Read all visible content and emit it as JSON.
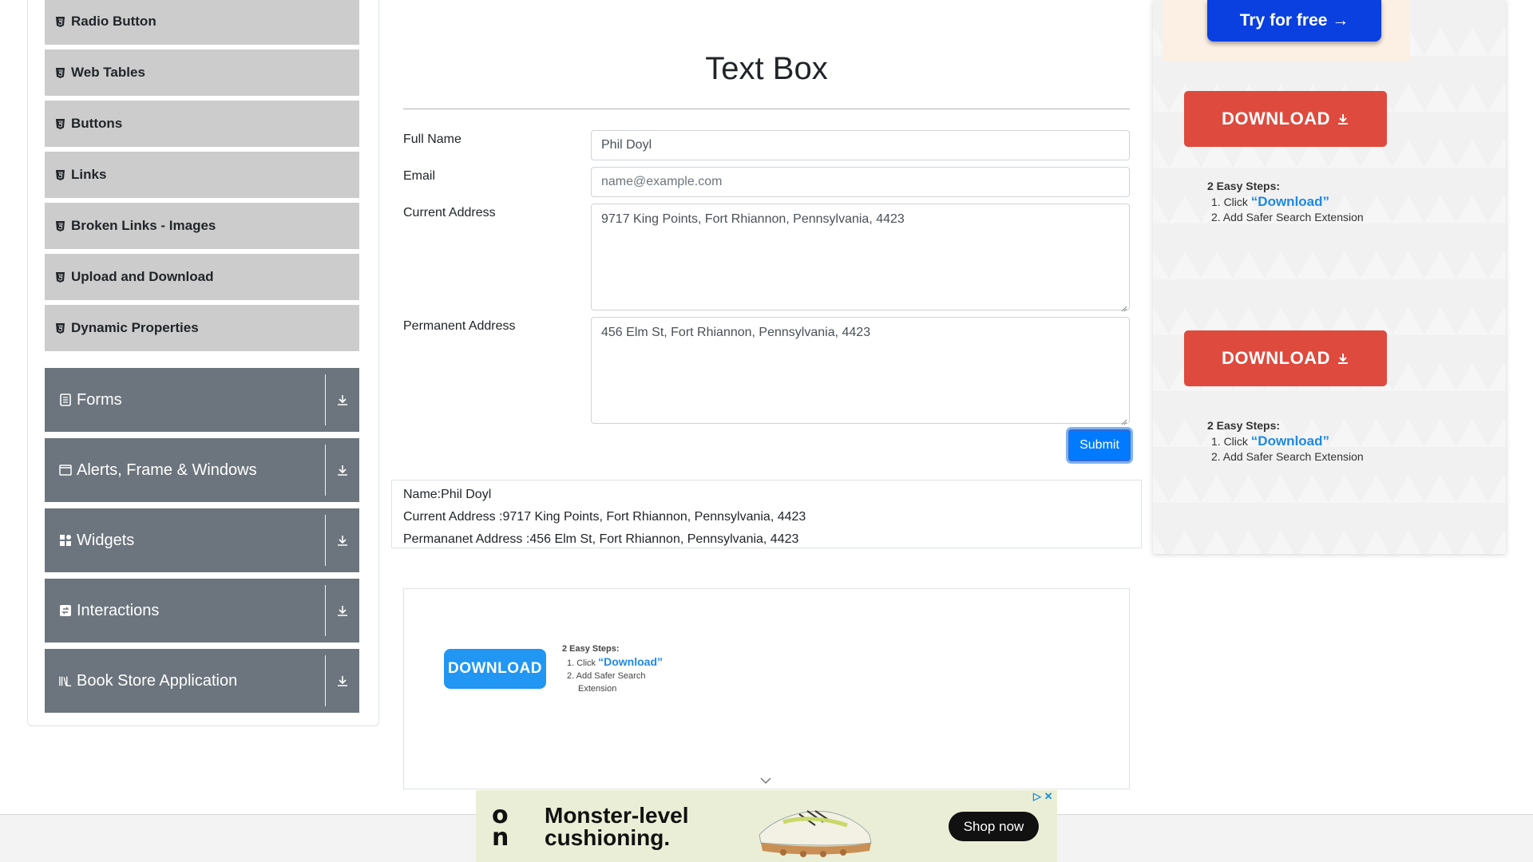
{
  "sidebar": {
    "sub_items": [
      {
        "label": "Radio Button"
      },
      {
        "label": "Web Tables"
      },
      {
        "label": "Buttons"
      },
      {
        "label": "Links"
      },
      {
        "label": "Broken Links - Images"
      },
      {
        "label": "Upload and Download"
      },
      {
        "label": "Dynamic Properties"
      }
    ],
    "groups": [
      {
        "label": "Forms",
        "icon": "form-icon"
      },
      {
        "label": "Alerts, Frame & Windows",
        "icon": "window-icon"
      },
      {
        "label": "Widgets",
        "icon": "widgets-icon"
      },
      {
        "label": "Interactions",
        "icon": "interactions-icon"
      },
      {
        "label": "Book Store Application",
        "icon": "book-icon"
      }
    ]
  },
  "main": {
    "title": "Text Box",
    "form": {
      "full_name_label": "Full Name",
      "full_name_value": "Phil Doyl",
      "email_label": "Email",
      "email_placeholder": "name@example.com",
      "current_address_label": "Current Address",
      "current_address_value": "9717 King Points, Fort Rhiannon, Pennsylvania, 4423",
      "permanent_address_label": "Permanent Address",
      "permanent_address_value": "456 Elm St, Fort Rhiannon, Pennsylvania, 4423",
      "submit_label": "Submit"
    },
    "output": {
      "name_line": "Name:Phil Doyl",
      "current_line": "Current Address :9717 King Points, Fort Rhiannon, Pennsylvania, 4423",
      "permanent_line": "Permananet Address :456 Elm St, Fort Rhiannon, Pennsylvania, 4423"
    }
  },
  "ads": {
    "try_free": "Try for free →",
    "download": "DOWNLOAD",
    "steps_title": "2 Easy Steps:",
    "step1_prefix": "1. Click ",
    "step1_word": "“Download”",
    "step2": "2. Add Safer Search Extension",
    "step2_a": "2. Add Safer Search",
    "step2_b": "Extension",
    "banner_logo": "on",
    "banner_headline_1": "Monster-level",
    "banner_headline_2": "cushioning.",
    "banner_cta": "Shop now",
    "banner_adchoice": "▷ ✕"
  },
  "colors": {
    "primary": "#007bff",
    "sidebar_group": "#6c757d",
    "sidebar_sub": "#cccccc",
    "download_red": "#de4a3d",
    "download_blue": "#2196f3",
    "try_blue": "#0a3fe0"
  }
}
